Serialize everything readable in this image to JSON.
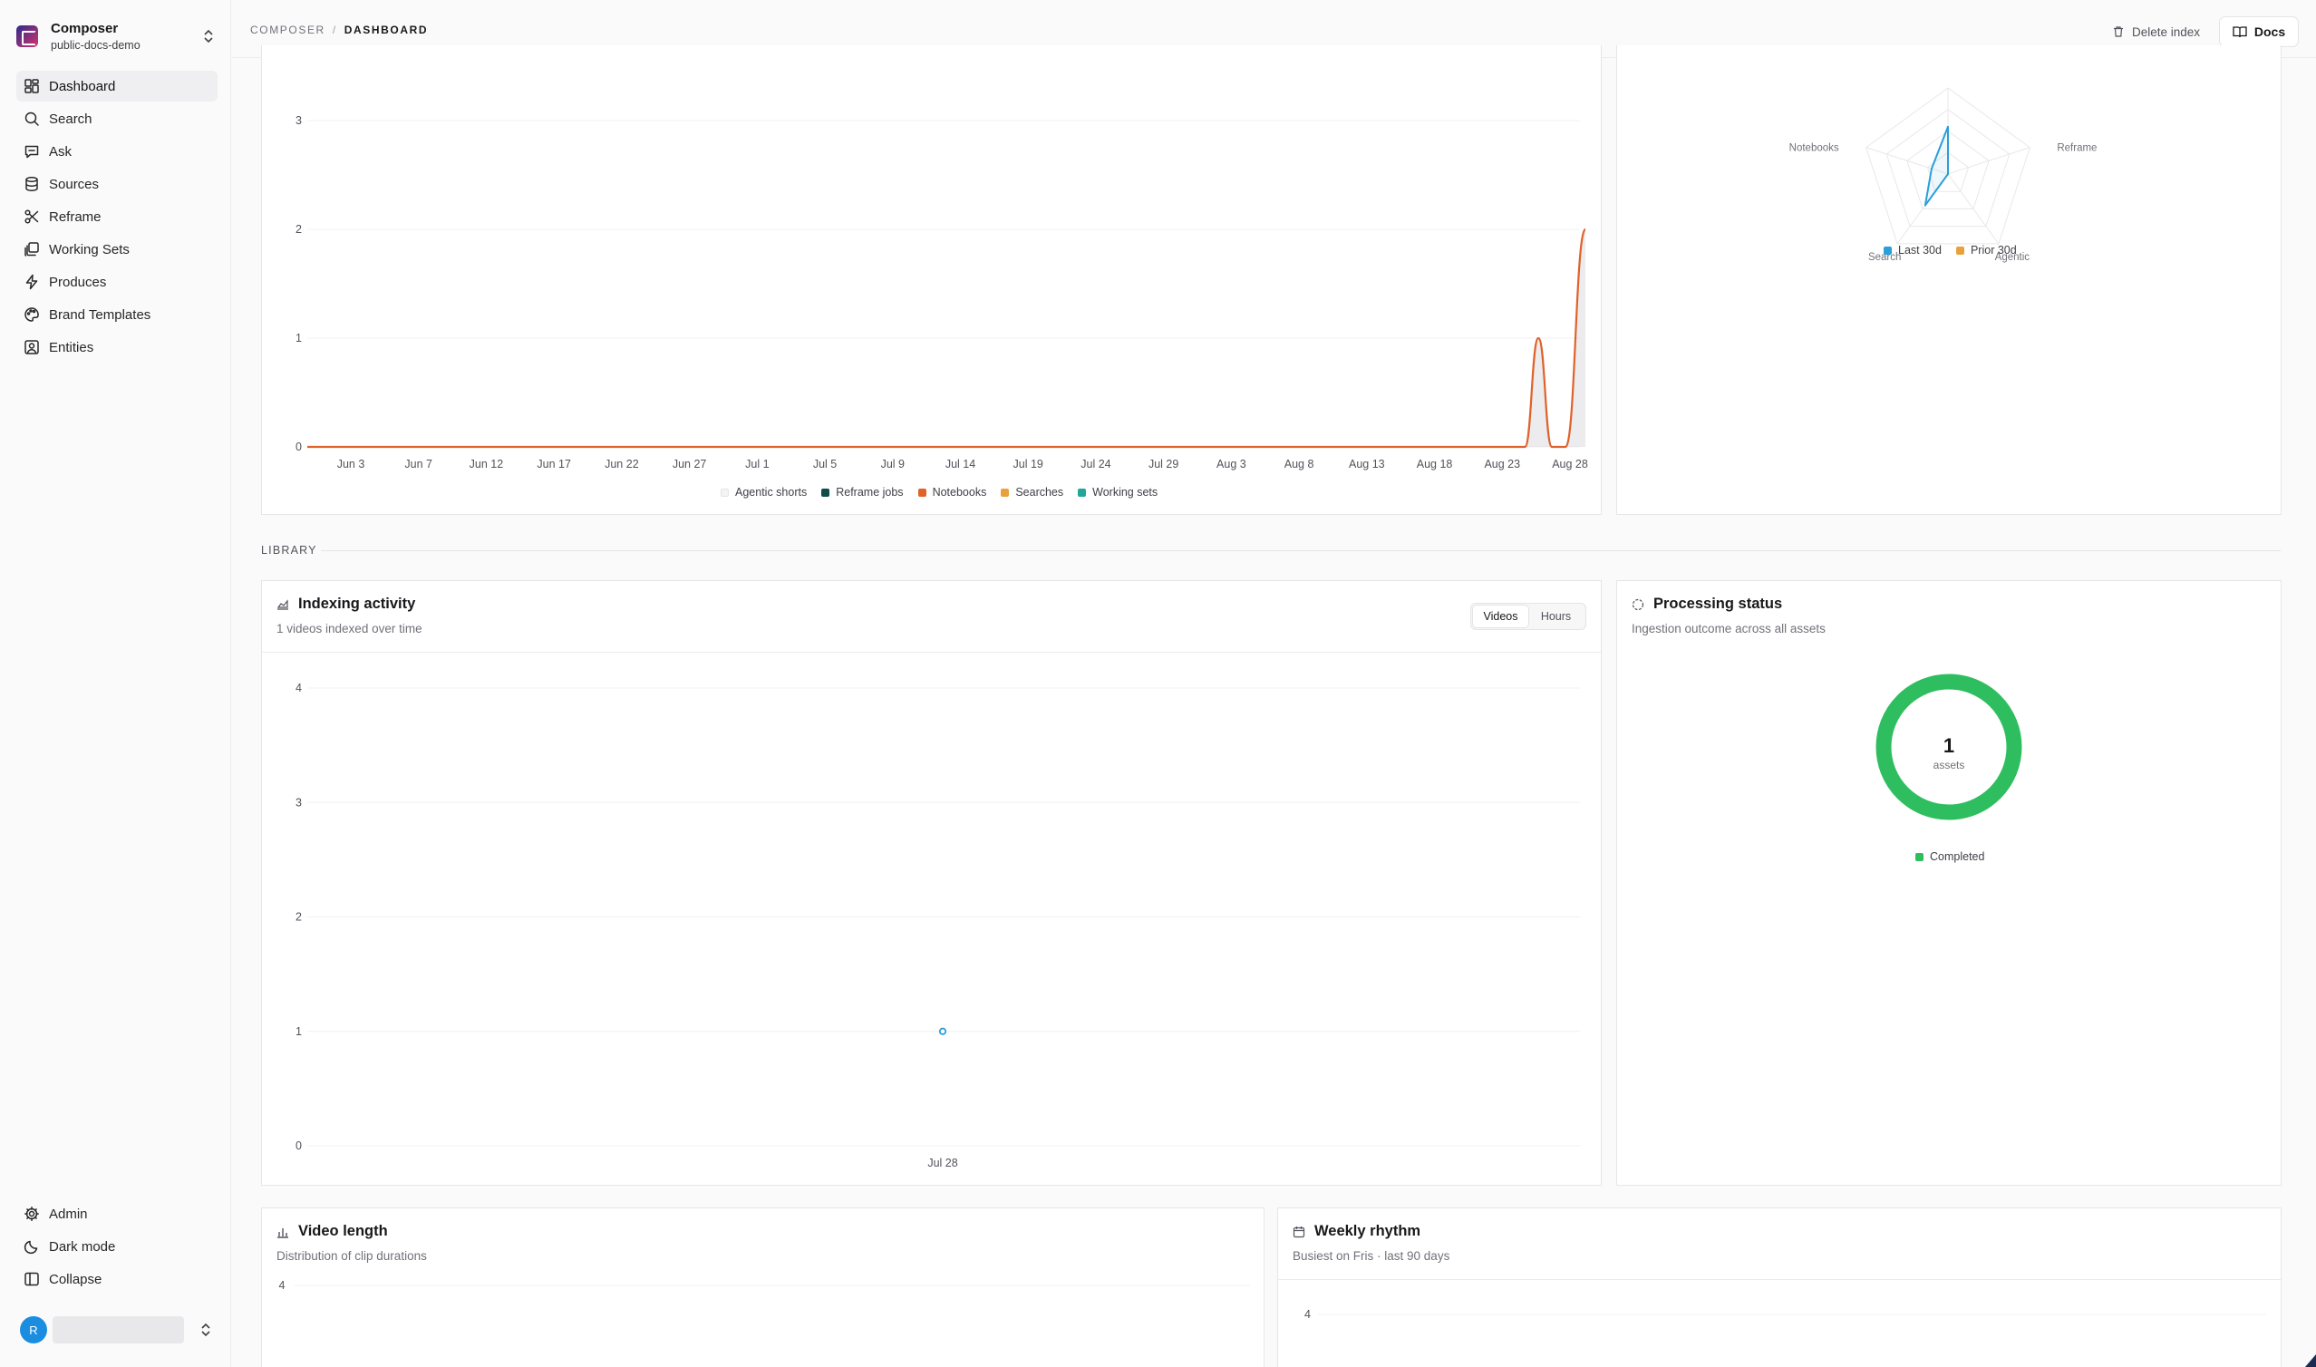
{
  "workspace": {
    "name": "Composer",
    "project": "public-docs-demo"
  },
  "nav": [
    {
      "label": "Dashboard",
      "icon": "dashboard-icon",
      "active": true
    },
    {
      "label": "Search",
      "icon": "search-icon"
    },
    {
      "label": "Ask",
      "icon": "chat-icon"
    },
    {
      "label": "Sources",
      "icon": "database-icon"
    },
    {
      "label": "Reframe",
      "icon": "scissors-icon"
    },
    {
      "label": "Working Sets",
      "icon": "layers-icon"
    },
    {
      "label": "Produces",
      "icon": "bolt-icon"
    },
    {
      "label": "Brand Templates",
      "icon": "palette-icon"
    },
    {
      "label": "Entities",
      "icon": "contact-icon"
    }
  ],
  "nav_bottom": [
    {
      "label": "Admin",
      "icon": "gear-icon"
    },
    {
      "label": "Dark mode",
      "icon": "moon-icon"
    },
    {
      "label": "Collapse",
      "icon": "sidebar-icon"
    }
  ],
  "user": {
    "initial": "R"
  },
  "header": {
    "crumb_root": "COMPOSER",
    "crumb_sep": "/",
    "crumb_current": "DASHBOARD",
    "delete_label": "Delete index",
    "docs_label": "Docs"
  },
  "library_label": "LIBRARY",
  "indexing": {
    "title": "Indexing activity",
    "subtitle": "1 videos indexed over time",
    "toggle": [
      "Videos",
      "Hours"
    ],
    "toggle_selected": "Videos"
  },
  "processing": {
    "title": "Processing status",
    "subtitle": "Ingestion outcome across all assets",
    "count": "1",
    "count_label": "assets"
  },
  "video_length": {
    "title": "Video length",
    "subtitle": "Distribution of clip durations"
  },
  "weekly": {
    "title": "Weekly rhythm",
    "subtitle": "Busiest on Fris · last 90 days"
  },
  "colors": {
    "agentic_shorts": "#f4f4f5",
    "reframe_jobs": "#0f4c4a",
    "notebooks": "#e0622b",
    "searches": "#e9a23b",
    "working_sets": "#23a69a",
    "last_30d": "#2a9fd8",
    "prior_30d": "#e9a23b",
    "completed": "#2fbe5f"
  },
  "chart_data": [
    {
      "type": "line",
      "x_ticks": [
        "Jun 3",
        "Jun 7",
        "Jun 12",
        "Jun 17",
        "Jun 22",
        "Jun 27",
        "Jul 1",
        "Jul 5",
        "Jul 9",
        "Jul 14",
        "Jul 19",
        "Jul 24",
        "Jul 29",
        "Aug 3",
        "Aug 8",
        "Aug 13",
        "Aug 18",
        "Aug 23",
        "Aug 28"
      ],
      "y_ticks": [
        "0",
        "1",
        "2",
        "3"
      ],
      "ylim": [
        0,
        3.5
      ],
      "series": [
        {
          "name": "Agentic shorts",
          "values": []
        },
        {
          "name": "Reframe jobs",
          "values": []
        },
        {
          "name": "Notebooks",
          "x": [
            "Jun 3",
            "Aug 24",
            "Aug 25",
            "Aug 26",
            "Aug 27",
            "Aug 28"
          ],
          "values": [
            0,
            0,
            1,
            0,
            0,
            2
          ]
        },
        {
          "name": "Searches",
          "values": []
        },
        {
          "name": "Working sets",
          "values": []
        }
      ]
    },
    {
      "type": "radar",
      "axes": [
        "Reframe",
        "Agentic",
        "Search",
        "Notebooks"
      ],
      "series": [
        {
          "name": "Last 30d",
          "values": [
            0,
            0,
            0.45,
            0.2
          ]
        },
        {
          "name": "Prior 30d",
          "values": [
            0,
            0,
            0,
            0
          ]
        }
      ]
    },
    {
      "type": "line",
      "x_ticks": [
        "Jul 28"
      ],
      "y_ticks": [
        "0",
        "1",
        "2",
        "3",
        "4"
      ],
      "ylim": [
        0,
        4
      ],
      "series": [
        {
          "name": "Videos",
          "x": [
            "Jul 28"
          ],
          "values": [
            1
          ]
        }
      ]
    },
    {
      "type": "pie",
      "categories": [
        "Completed"
      ],
      "values": [
        1
      ]
    },
    {
      "type": "bar",
      "y_ticks": [
        "4"
      ],
      "series": []
    },
    {
      "type": "bar",
      "y_ticks": [
        "4"
      ],
      "series": []
    }
  ]
}
